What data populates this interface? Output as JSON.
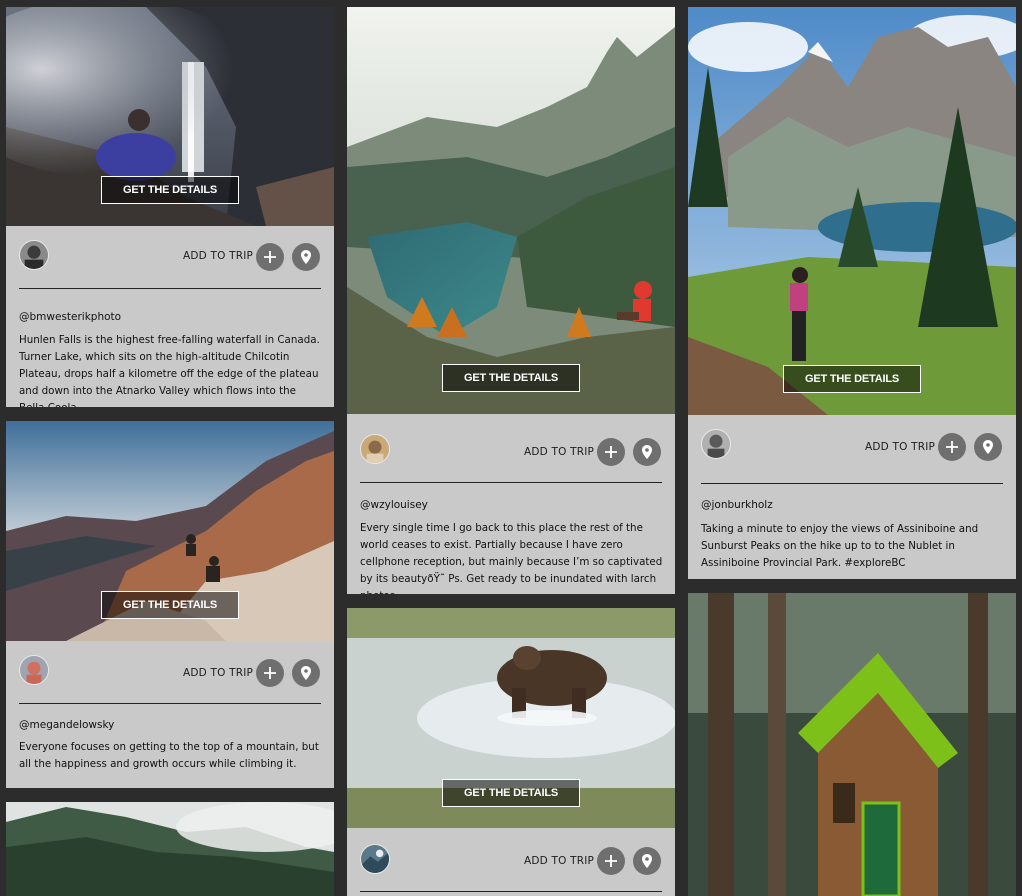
{
  "ui": {
    "details_label": "GET THE DETAILS",
    "add_to_trip_label": "ADD TO TRIP"
  },
  "cards": {
    "waterfall": {
      "handle": "@bmwesterikphoto",
      "caption": "Hunlen Falls is the highest free-falling waterfall in Canada. Turner Lake, which sits on the high-altitude Chilcotin Plateau, drops half a kilometre off the edge of the plateau and down into the Atnarko Valley which flows into the Bella Coola."
    },
    "lake": {
      "handle": "@wzylouisey",
      "caption": "Every single time I go back to this place the rest of the world ceases to exist. Partially because I have zero cellphone reception, but mainly because I’m so captivated by its beautyðŸ˜ Ps. Get ready to be inundated with larch photos."
    },
    "assiniboine": {
      "handle": "@jonburkholz",
      "caption": "Taking a minute to enjoy the views of Assiniboine and Sunburst Peaks on the hike up to to the Nublet in Assiniboine Provincial Park. #exploreBC"
    },
    "sunset": {
      "handle": "@megandelowsky",
      "caption": "Everyone focuses on getting to the top of a mountain, but all the happiness and growth occurs while climbing it."
    },
    "bear": {},
    "forest": {},
    "cabin": {}
  },
  "icons": {
    "add": "plus-icon",
    "location": "map-pin-icon"
  }
}
